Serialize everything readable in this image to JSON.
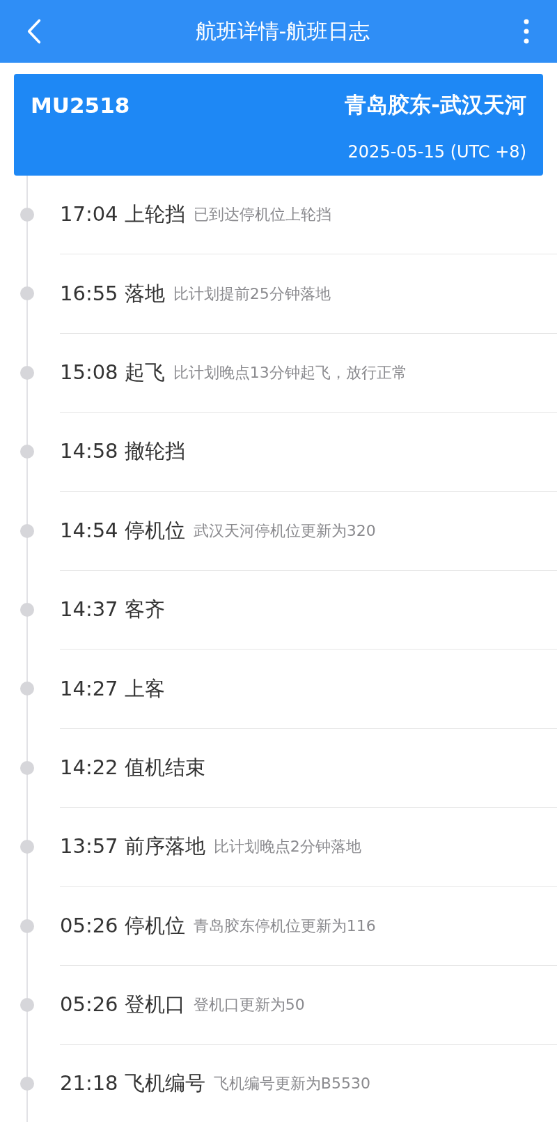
{
  "header": {
    "title": "航班详情-航班日志"
  },
  "flight": {
    "number": "MU2518",
    "route": "青岛胶东-武汉天河",
    "date": "2025-05-15 (UTC +8)"
  },
  "events": [
    {
      "time": "17:04",
      "event": "上轮挡",
      "detail": "已到达停机位上轮挡"
    },
    {
      "time": "16:55",
      "event": "落地",
      "detail": "比计划提前25分钟落地"
    },
    {
      "time": "15:08",
      "event": "起飞",
      "detail": "比计划晚点13分钟起飞，放行正常"
    },
    {
      "time": "14:58",
      "event": "撤轮挡"
    },
    {
      "time": "14:54",
      "event": "停机位",
      "detail": "武汉天河停机位更新为320"
    },
    {
      "time": "14:37",
      "event": "客齐"
    },
    {
      "time": "14:27",
      "event": "上客"
    },
    {
      "time": "14:22",
      "event": "值机结束"
    },
    {
      "time": "13:57",
      "event": "前序落地",
      "detail": "比计划晚点2分钟落地"
    },
    {
      "time": "05:26",
      "event": "停机位",
      "detail": "青岛胶东停机位更新为116"
    },
    {
      "time": "05:26",
      "event": "登机口",
      "detail": "登机口更新为50"
    },
    {
      "time": "21:18",
      "event": "飞机编号",
      "detail": "飞机编号更新为B5530"
    }
  ]
}
